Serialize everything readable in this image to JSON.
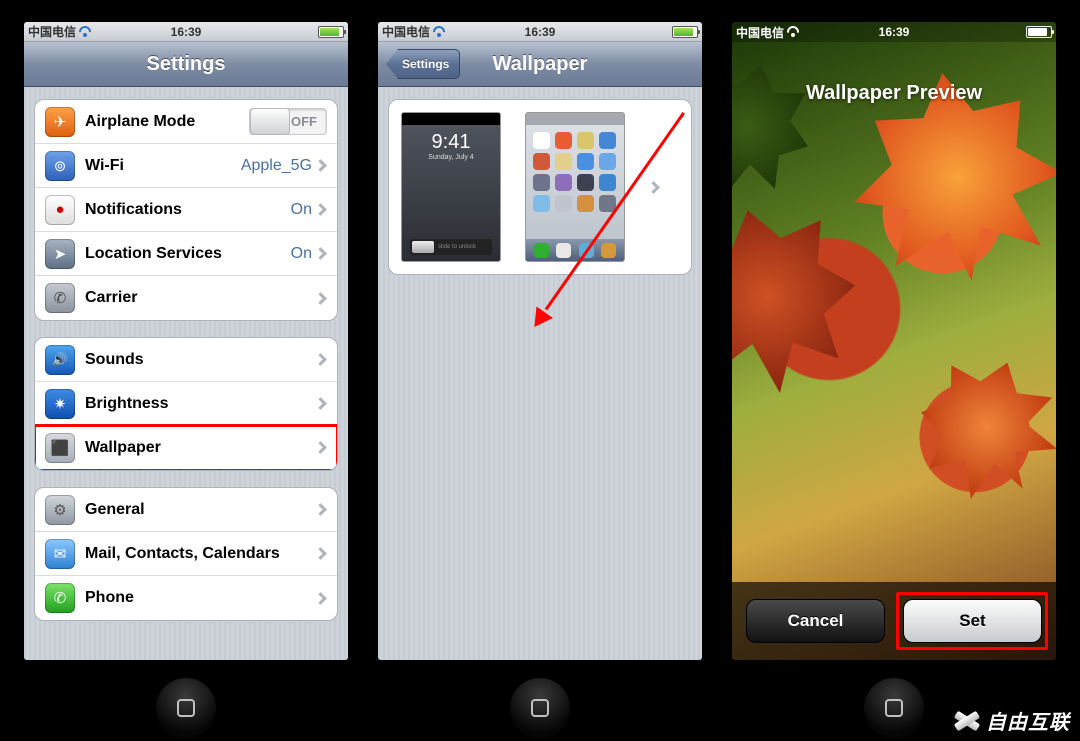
{
  "status": {
    "carrier": "中国电信",
    "time": "16:39"
  },
  "phone1": {
    "title": "Settings",
    "airplane": {
      "label": "Airplane Mode",
      "switch": "OFF"
    },
    "wifi": {
      "label": "Wi-Fi",
      "value": "Apple_5G"
    },
    "notif": {
      "label": "Notifications",
      "value": "On"
    },
    "loc": {
      "label": "Location Services",
      "value": "On"
    },
    "carrier": {
      "label": "Carrier"
    },
    "sounds": {
      "label": "Sounds"
    },
    "bright": {
      "label": "Brightness"
    },
    "wall": {
      "label": "Wallpaper"
    },
    "general": {
      "label": "General"
    },
    "mail": {
      "label": "Mail, Contacts, Calendars"
    },
    "phone": {
      "label": "Phone"
    }
  },
  "phone2": {
    "back": "Settings",
    "title": "Wallpaper",
    "lockthumb": {
      "time": "9:41",
      "date": "Sunday, July 4",
      "slide": "slide to unlock"
    }
  },
  "phone3": {
    "title": "Wallpaper Preview",
    "cancel": "Cancel",
    "set": "Set"
  },
  "watermark": "自由互联",
  "icons": {
    "airplane": "✈",
    "wifi": "⊚",
    "notif": "●",
    "loc": "➤",
    "carrier": "✆",
    "sounds": "🔊",
    "bright": "✷",
    "wall": "⬛",
    "general": "⚙",
    "mail": "✉",
    "phone": "✆"
  }
}
